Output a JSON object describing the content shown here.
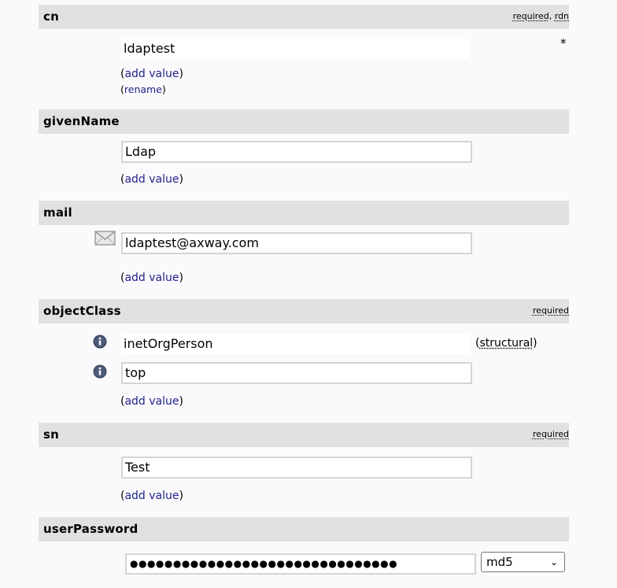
{
  "attributes": [
    {
      "name": "cn",
      "meta": [
        "required",
        "rdn"
      ],
      "value": "ldaptest",
      "add_value": "add value",
      "rename": "rename",
      "rdn_marker": "*"
    },
    {
      "name": "givenName",
      "value": "Ldap",
      "add_value": "add value"
    },
    {
      "name": "mail",
      "value": "ldaptest@axway.com",
      "add_value": "add value"
    },
    {
      "name": "objectClass",
      "meta": [
        "required"
      ],
      "values": [
        "inetOrgPerson",
        "top"
      ],
      "structural": "structural",
      "add_value": "add value"
    },
    {
      "name": "sn",
      "meta": [
        "required"
      ],
      "value": "Test",
      "add_value": "add value"
    },
    {
      "name": "userPassword",
      "value": "●●●●●●●●●●●●●●●●●●●●●●●●●●●●●●●",
      "hash_selected": "md5"
    }
  ],
  "icons": {
    "mail": "envelope-icon",
    "info": "info-icon",
    "dropdown": "chevron-down-icon"
  },
  "colors": {
    "header_bg": "#e1e1e1",
    "link": "#22228a",
    "page_bg": "#fafafd"
  }
}
